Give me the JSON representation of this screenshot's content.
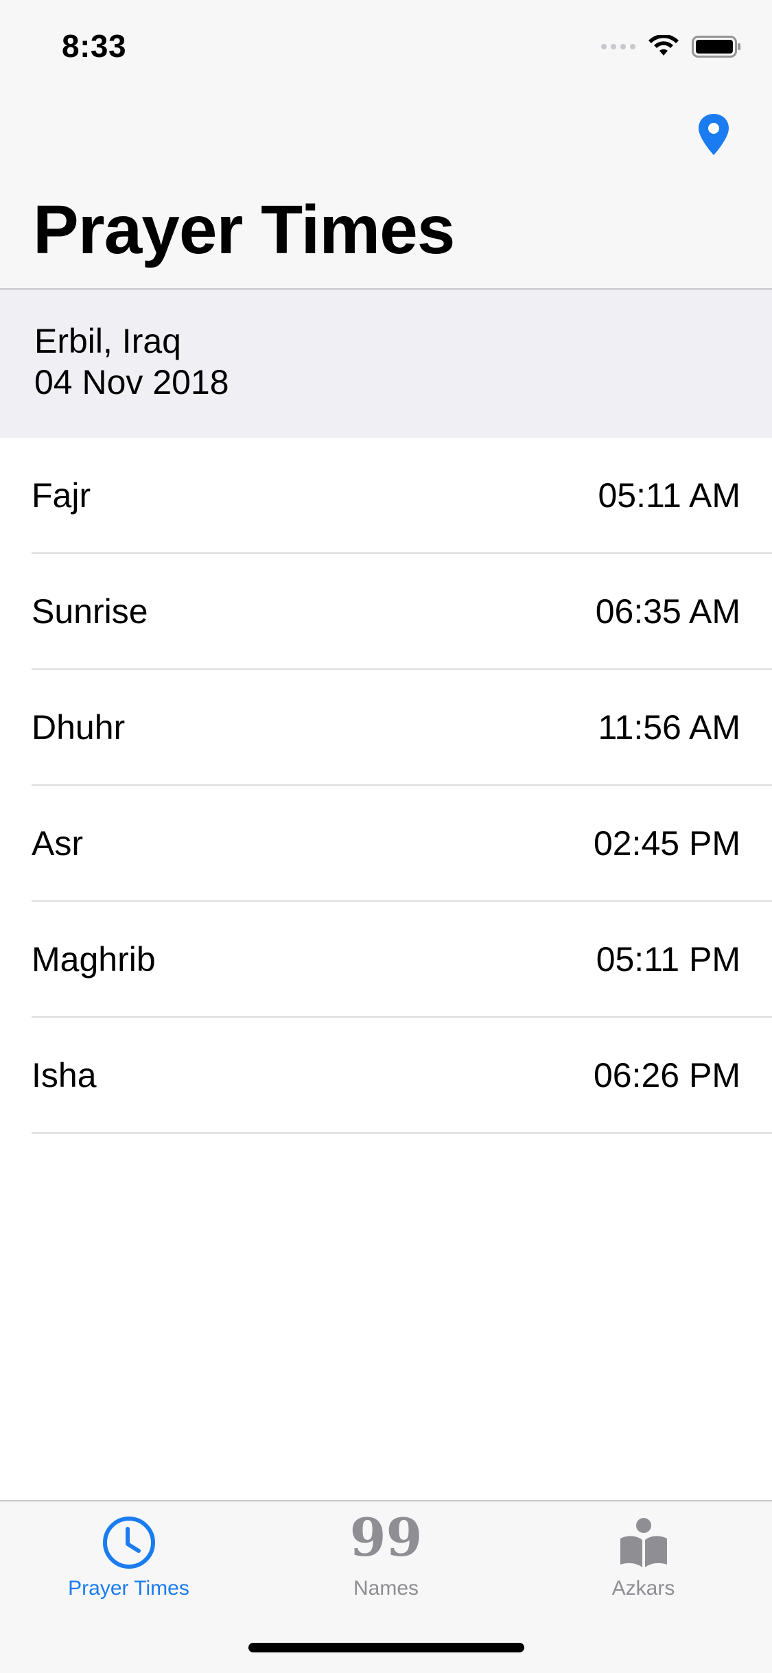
{
  "status_bar": {
    "time": "8:33"
  },
  "nav": {
    "title": "Prayer Times"
  },
  "header": {
    "city": "Erbil, Iraq",
    "date": "04 Nov 2018"
  },
  "prayers": [
    {
      "name": "Fajr",
      "time": "05:11 AM"
    },
    {
      "name": "Sunrise",
      "time": "06:35 AM"
    },
    {
      "name": "Dhuhr",
      "time": "11:56 AM"
    },
    {
      "name": "Asr",
      "time": "02:45 PM"
    },
    {
      "name": "Maghrib",
      "time": "05:11 PM"
    },
    {
      "name": "Isha",
      "time": "06:26 PM"
    }
  ],
  "tabs": [
    {
      "label": "Prayer Times",
      "icon": "clock-icon",
      "active": true
    },
    {
      "label": "Names",
      "icon": "ninety-nine-icon",
      "icon_text": "99",
      "active": false
    },
    {
      "label": "Azkars",
      "icon": "book-reader-icon",
      "active": false
    }
  ],
  "colors": {
    "accent": "#1a7cf0",
    "inactive": "#8e8e93",
    "header_bg": "#efeff4"
  }
}
